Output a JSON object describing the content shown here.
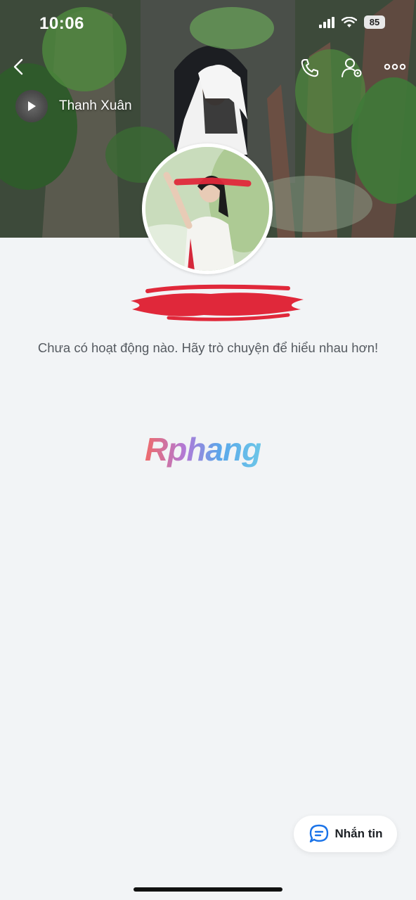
{
  "status_bar": {
    "time": "10:06",
    "battery": "85"
  },
  "header": {
    "back_icon": "chevron-left-icon",
    "call_icon": "phone-icon",
    "settings_icon": "user-settings-icon",
    "more_icon": "more-horizontal-icon"
  },
  "cover": {
    "music_title": "Thanh Xuân",
    "music_icon": "play-icon"
  },
  "profile": {
    "empty_message": "Chưa có hoạt động nào. Hãy trò chuyện để hiểu nhau hơn!"
  },
  "watermark": {
    "text": "Rphang"
  },
  "actions": {
    "message_label": "Nhắn tin",
    "message_icon": "chat-bubble-icon"
  },
  "colors": {
    "background": "#f2f4f6",
    "accent": "#1a73e8",
    "redaction": "#e0283a"
  }
}
